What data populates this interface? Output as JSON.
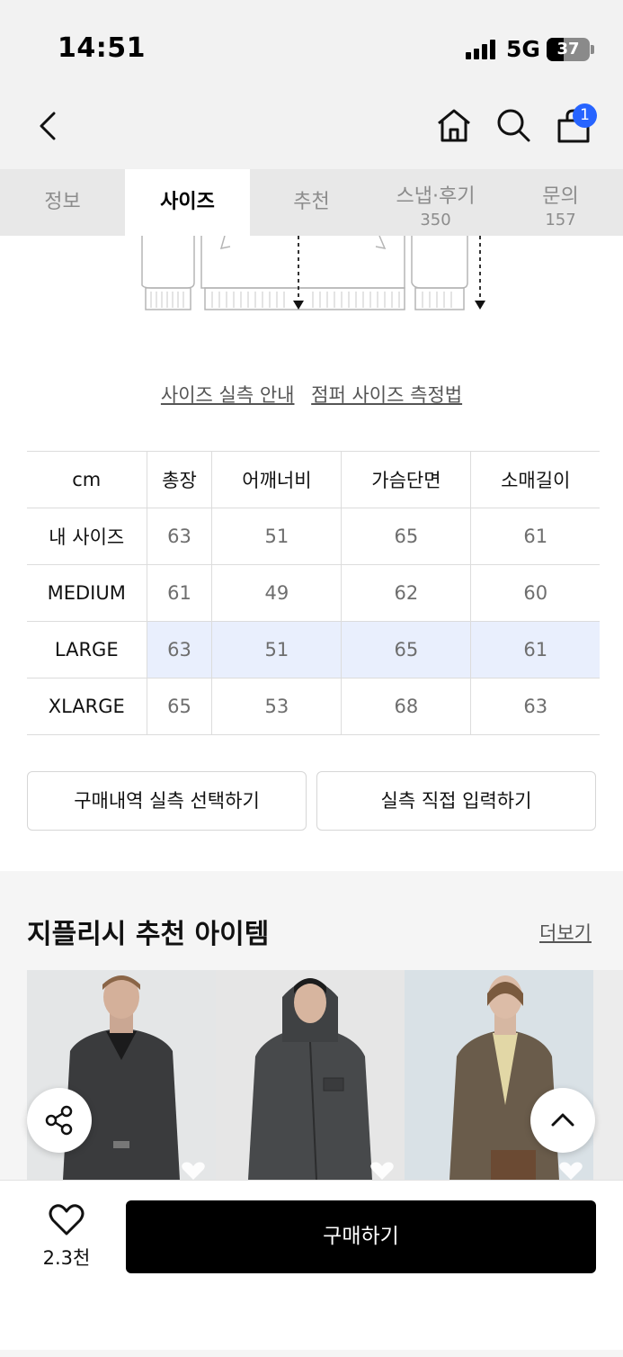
{
  "status": {
    "time": "14:51",
    "network": "5G",
    "battery": "37"
  },
  "header": {
    "cart_count": "1"
  },
  "tabs": [
    {
      "label": "정보",
      "sub": ""
    },
    {
      "label": "사이즈",
      "sub": ""
    },
    {
      "label": "추천",
      "sub": ""
    },
    {
      "label": "스냅·후기",
      "sub": "350"
    },
    {
      "label": "문의",
      "sub": "157"
    }
  ],
  "links": {
    "guide": "사이즈 실측 안내",
    "method": "점퍼 사이즈 측정법"
  },
  "size_table": {
    "unit": "cm",
    "columns": [
      "총장",
      "어깨너비",
      "가슴단면",
      "소매길이"
    ],
    "rows": [
      {
        "label": "내 사이즈",
        "values": [
          "63",
          "51",
          "65",
          "61"
        ],
        "highlight": false
      },
      {
        "label": "MEDIUM",
        "values": [
          "61",
          "49",
          "62",
          "60"
        ],
        "highlight": false
      },
      {
        "label": "LARGE",
        "values": [
          "63",
          "51",
          "65",
          "61"
        ],
        "highlight": true
      },
      {
        "label": "XLARGE",
        "values": [
          "65",
          "53",
          "68",
          "63"
        ],
        "highlight": false
      }
    ]
  },
  "buttons": {
    "history": "구매내역 실측 선택하기",
    "manual": "실측 직접 입력하기"
  },
  "recommend": {
    "title": "지플리시 추천 아이템",
    "more": "더보기"
  },
  "bottom": {
    "likes": "2.3천",
    "buy": "구매하기"
  },
  "colors": {
    "accent": "#2764ff",
    "highlight_row": "#e9effd",
    "buy_button": "#000000"
  }
}
